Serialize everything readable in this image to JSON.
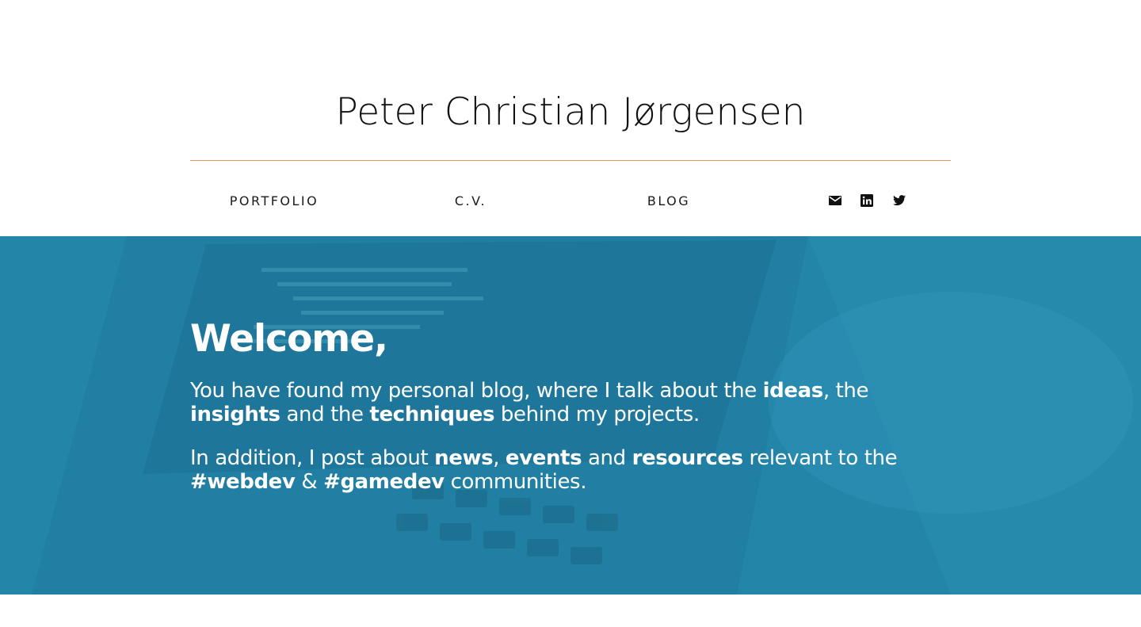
{
  "header": {
    "site_title": "Peter Christian Jørgensen",
    "divider_color": "#e39a53"
  },
  "nav": {
    "items": [
      {
        "label": "PORTFOLIO"
      },
      {
        "label": "C.V."
      },
      {
        "label": "BLOG"
      }
    ],
    "social": [
      {
        "icon": "mail-icon"
      },
      {
        "icon": "linkedin-icon"
      },
      {
        "icon": "twitter-icon"
      }
    ]
  },
  "hero": {
    "background_color": "#2385a8",
    "title": "Welcome,",
    "p1": {
      "t1": "You have found my personal blog, where I talk about the ",
      "b1": "ideas",
      "t2": ", the ",
      "b2": "insights",
      "t3": " and the ",
      "b3": "techniques",
      "t4": " behind my projects."
    },
    "p2": {
      "t1": "In addition, I post about ",
      "b1": "news",
      "t2": ", ",
      "b2": "events",
      "t3": " and ",
      "b3": "resources",
      "t4": " relevant to the ",
      "b4": "#webdev",
      "t5": " & ",
      "b5": "#gamedev",
      "t6": " communities."
    }
  }
}
